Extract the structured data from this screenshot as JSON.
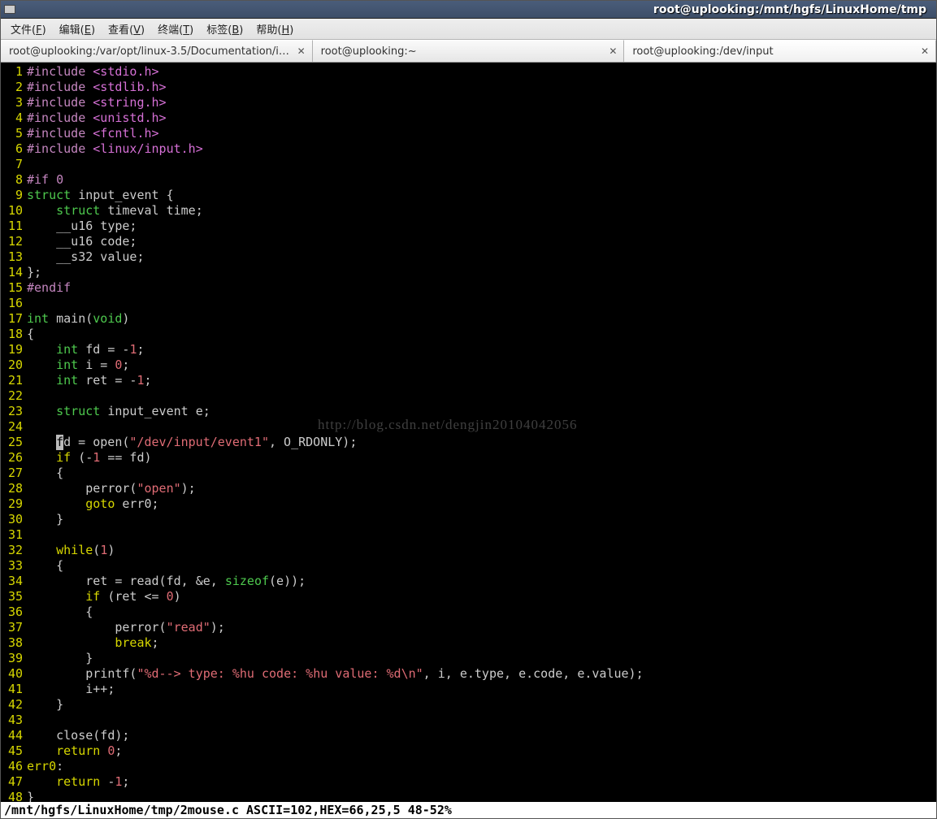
{
  "titlebar": {
    "title": "root@uplooking:/mnt/hgfs/LinuxHome/tmp"
  },
  "menu": {
    "file": "文件",
    "file_key": "F",
    "edit": "编辑",
    "edit_key": "E",
    "view": "查看",
    "view_key": "V",
    "terminal": "终端",
    "terminal_key": "T",
    "tabs": "标签",
    "tabs_key": "B",
    "help": "帮助",
    "help_key": "H"
  },
  "tabs": [
    {
      "label": "root@uplooking:/var/opt/linux-3.5/Documentation/i…"
    },
    {
      "label": "root@uplooking:~"
    },
    {
      "label": "root@uplooking:/dev/input"
    }
  ],
  "code": {
    "l1": {
      "include": "#include",
      "header": "<stdio.h>"
    },
    "l2": {
      "include": "#include",
      "header": "<stdlib.h>"
    },
    "l3": {
      "include": "#include",
      "header": "<string.h>"
    },
    "l4": {
      "include": "#include",
      "header": "<unistd.h>"
    },
    "l5": {
      "include": "#include",
      "header": "<fcntl.h>"
    },
    "l6": {
      "include": "#include",
      "header": "<linux/input.h>"
    },
    "l8": {
      "if0": "#if 0"
    },
    "l9": {
      "struct": "struct",
      "name": "input_event {"
    },
    "l10": {
      "struct": "struct",
      "rest": " timeval time;"
    },
    "l11": {
      "rest": "__u16 type;"
    },
    "l12": {
      "rest": "__u16 code;"
    },
    "l13": {
      "rest": "__s32 value;"
    },
    "l14": {
      "rest": "};"
    },
    "l15": {
      "endif": "#endif"
    },
    "l17": {
      "int": "int",
      "main": " main(",
      "void": "void",
      "close": ")"
    },
    "l18": {
      "br": "{"
    },
    "l19": {
      "int": "int",
      "var": " fd = -",
      "num": "1",
      "semi": ";"
    },
    "l20": {
      "int": "int",
      "var": " i = ",
      "num": "0",
      "semi": ";"
    },
    "l21": {
      "int": "int",
      "var": " ret = -",
      "num": "1",
      "semi": ";"
    },
    "l23": {
      "struct": "struct",
      "rest": " input_event e;"
    },
    "l25": {
      "pre": "    ",
      "cur": "f",
      "post": "d = open(",
      "str": "\"/dev/input/event1\"",
      "tail": ", O_RDONLY);"
    },
    "l26": {
      "if": "if",
      "a": " (-",
      "num": "1",
      "b": " == fd)"
    },
    "l27": {
      "br": "    {"
    },
    "l28": {
      "pre": "        perror(",
      "str": "\"open\"",
      "post": ");"
    },
    "l29": {
      "goto": "goto",
      "lbl": " err0;"
    },
    "l30": {
      "br": "    }"
    },
    "l32": {
      "while": "while",
      "a": "(",
      "num": "1",
      "b": ")"
    },
    "l33": {
      "br": "    {"
    },
    "l34": {
      "rest": "        ret = read(fd, &e, ",
      "sizeof": "sizeof",
      "post": "(e));"
    },
    "l35": {
      "if": "if",
      "a": " (ret <= ",
      "num": "0",
      "b": ")"
    },
    "l36": {
      "br": "        {"
    },
    "l37": {
      "pre": "            perror(",
      "str": "\"read\"",
      "post": ");"
    },
    "l38": {
      "break": "break",
      "semi": ";"
    },
    "l39": {
      "br": "        }"
    },
    "l40": {
      "pre": "        printf(",
      "str": "\"%d--> type: %hu code: %hu value: %d\\n\"",
      "post": ", i, e.type, e.code, e.value);"
    },
    "l41": {
      "rest": "        i++;"
    },
    "l42": {
      "br": "    }"
    },
    "l44": {
      "rest": "    close(fd);"
    },
    "l45": {
      "return": "return",
      "sp": " ",
      "num": "0",
      "semi": ";"
    },
    "l46": {
      "lbl": "err0",
      "colon": ":"
    },
    "l47": {
      "return": "return",
      "sp": " -",
      "num": "1",
      "semi": ";"
    },
    "l48": {
      "br": "}"
    }
  },
  "watermark": "http://blog.csdn.net/dengjin20104042056",
  "status": "/mnt/hgfs/LinuxHome/tmp/2mouse.c ASCII=102,HEX=66,25,5 48-52%"
}
